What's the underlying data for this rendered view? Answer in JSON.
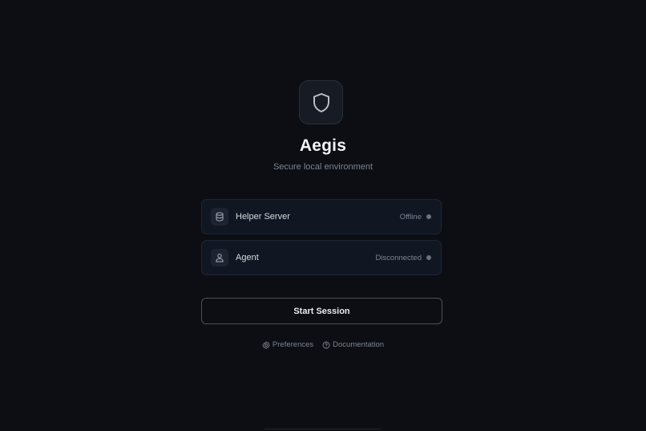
{
  "app": {
    "title": "Aegis",
    "subtitle": "Secure local environment",
    "logo_icon": "shield-icon"
  },
  "services": [
    {
      "label": "Helper Server",
      "status": "Offline",
      "icon": "database-icon",
      "status_color": "#6b7280"
    },
    {
      "label": "Agent",
      "status": "Disconnected",
      "icon": "user-icon",
      "status_color": "#6b7280"
    }
  ],
  "actions": {
    "start_label": "Start Session"
  },
  "footer": {
    "preferences_label": "Preferences",
    "preferences_icon": "gear-icon",
    "documentation_label": "Documentation",
    "documentation_icon": "help-circle-icon"
  },
  "colors": {
    "background": "#0c0e13",
    "card": "#111722",
    "muted_text": "#7c8493",
    "status_dot": "#6b7280"
  }
}
